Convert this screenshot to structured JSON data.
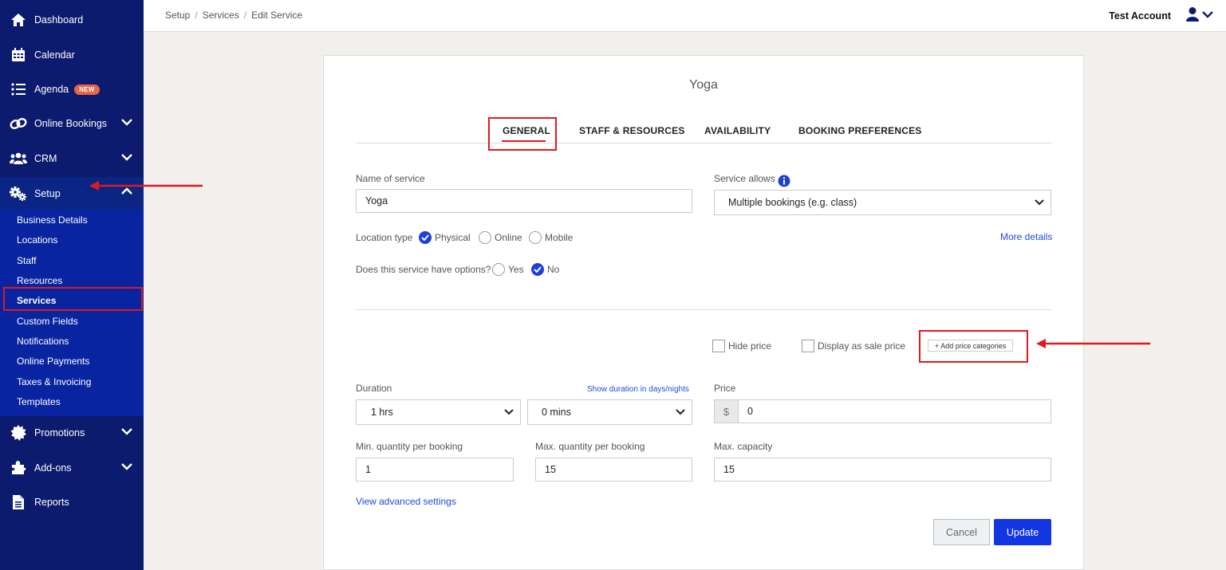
{
  "sidebar": {
    "items": [
      {
        "label": "Dashboard",
        "icon": "home-icon"
      },
      {
        "label": "Calendar",
        "icon": "calendar-icon"
      },
      {
        "label": "Agenda",
        "icon": "list-icon",
        "badge": "NEW"
      },
      {
        "label": "Online Bookings",
        "icon": "link-icon"
      },
      {
        "label": "CRM",
        "icon": "users-icon"
      },
      {
        "label": "Setup",
        "icon": "gears-icon"
      },
      {
        "label": "Promotions",
        "icon": "starburst-icon"
      },
      {
        "label": "Add-ons",
        "icon": "puzzle-icon"
      },
      {
        "label": "Reports",
        "icon": "document-icon"
      }
    ],
    "setup_sub": [
      "Business Details",
      "Locations",
      "Staff",
      "Resources",
      "Services",
      "Custom Fields",
      "Notifications",
      "Online Payments",
      "Taxes & Invoicing",
      "Templates"
    ]
  },
  "topbar": {
    "breadcrumb": [
      "Setup",
      "Services",
      "Edit Service"
    ],
    "account": "Test Account"
  },
  "card": {
    "title": "Yoga",
    "tabs": [
      "GENERAL",
      "STAFF & RESOURCES",
      "AVAILABILITY",
      "BOOKING PREFERENCES"
    ],
    "name_label": "Name of service",
    "name_value": "Yoga",
    "allows_label": "Service allows",
    "allows_value": "Multiple bookings (e.g. class)",
    "location_label": "Location type",
    "location_options": [
      "Physical",
      "Online",
      "Mobile"
    ],
    "location_selected": "Physical",
    "more_details": "More details",
    "options_label": "Does this service have options?",
    "options_choices": [
      "Yes",
      "No"
    ],
    "options_selected": "No",
    "hide_price": "Hide price",
    "sale_price": "Display as sale price",
    "add_categories": "+ Add price categories",
    "duration_label": "Duration",
    "show_days": "Show duration in days/nights",
    "duration_hours": "1 hrs",
    "duration_mins": "0 mins",
    "price_label": "Price",
    "currency": "$",
    "price_value": "0",
    "min_qty_label": "Min. quantity per booking",
    "min_qty_value": "1",
    "max_qty_label": "Max. quantity per booking",
    "max_qty_value": "15",
    "max_cap_label": "Max. capacity",
    "max_cap_value": "15",
    "advanced": "View advanced settings",
    "cancel": "Cancel",
    "update": "Update"
  },
  "colors": {
    "sidebar": "#0d1b6e",
    "sidebar_sub": "#0824a0",
    "primary": "#1336e3",
    "highlight": "#e0191f"
  }
}
